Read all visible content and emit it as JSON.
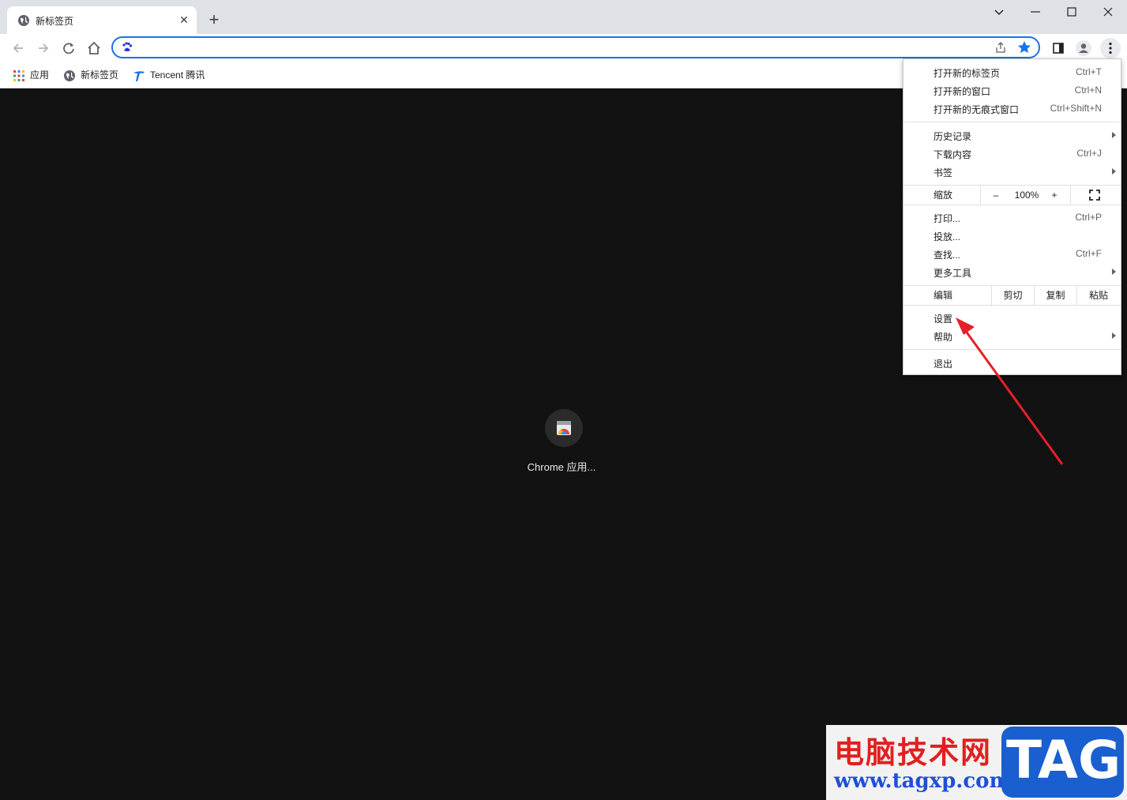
{
  "tab": {
    "title": "新标签页",
    "close": "✕",
    "new_tab": "+"
  },
  "omnibox": {
    "value": "",
    "placeholder": ""
  },
  "bookmarks": [
    {
      "label": "应用",
      "icon": "apps-grid-icon"
    },
    {
      "label": "新标签页",
      "icon": "globe-icon"
    },
    {
      "label": "Tencent 腾讯",
      "icon": "tencent-icon"
    }
  ],
  "app": {
    "label": "Chrome 应用..."
  },
  "menu": {
    "new_tab": {
      "label": "打开新的标签页",
      "shortcut": "Ctrl+T"
    },
    "new_window": {
      "label": "打开新的窗口",
      "shortcut": "Ctrl+N"
    },
    "incognito": {
      "label": "打开新的无痕式窗口",
      "shortcut": "Ctrl+Shift+N"
    },
    "history": {
      "label": "历史记录"
    },
    "downloads": {
      "label": "下载内容",
      "shortcut": "Ctrl+J"
    },
    "bookmarks": {
      "label": "书签"
    },
    "zoom": {
      "label": "缩放",
      "minus": "–",
      "value": "100%",
      "plus": "+"
    },
    "print": {
      "label": "打印...",
      "shortcut": "Ctrl+P"
    },
    "cast": {
      "label": "投放..."
    },
    "find": {
      "label": "查找...",
      "shortcut": "Ctrl+F"
    },
    "more_tools": {
      "label": "更多工具"
    },
    "edit": {
      "label": "编辑",
      "cut": "剪切",
      "copy": "复制",
      "paste": "粘贴"
    },
    "settings": {
      "label": "设置"
    },
    "help": {
      "label": "帮助"
    },
    "exit": {
      "label": "退出"
    }
  },
  "watermark": {
    "title": "电脑技术网",
    "url": "www.tagxp.com",
    "logo": "TAG"
  },
  "colors": {
    "accent": "#1a73e8",
    "annotation_arrow": "#e5202a",
    "content_bg": "#121212"
  }
}
